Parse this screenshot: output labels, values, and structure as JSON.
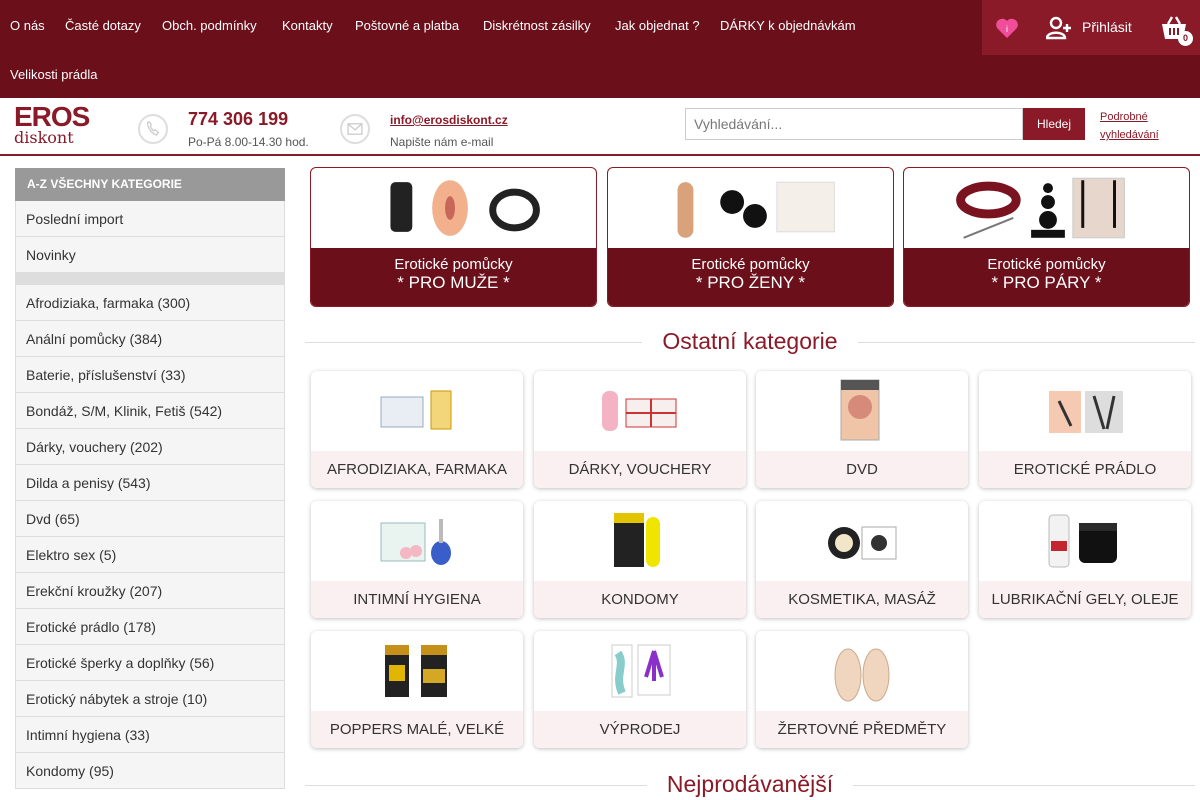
{
  "topnav": {
    "links": [
      "O nás",
      "Časté dotazy",
      "Obch. podmínky",
      "Kontakty",
      "Poštovné a platba",
      "Diskrétnost zásilky",
      "Jak objednat ?",
      "DÁRKY k objednávkám",
      "Velikosti prádla"
    ],
    "wishlist_badge": "i",
    "login_label": "Přihlásit",
    "cart_count": "0"
  },
  "header": {
    "logo_top": "EROS",
    "logo_bottom": "diskont",
    "phone": "774 306 199",
    "phone_hours": "Po-Pá 8.00-14.30 hod.",
    "email": "info@erosdiskont.cz",
    "email_note": "Napište nám e-mail",
    "search_placeholder": "Vyhledávání...",
    "search_button": "Hledej",
    "advanced_search": "Podrobné vyhledávání"
  },
  "sidebar": {
    "title": "A-Z VŠECHNY KATEGORIE",
    "top_items": [
      "Poslední import",
      "Novinky"
    ],
    "items": [
      "Afrodiziaka, farmaka (300)",
      "Anální pomůcky (384)",
      "Baterie, příslušenství (33)",
      "Bondáž, S/M, Klinik, Fetiš (542)",
      "Dárky, vouchery (202)",
      "Dilda a penisy (543)",
      "Dvd (65)",
      "Elektro sex (5)",
      "Erekční kroužky (207)",
      "Erotické prádlo (178)",
      "Erotické šperky a doplňky (56)",
      "Erotický nábytek a stroje (10)",
      "Intimní hygiena (33)",
      "Kondomy (95)"
    ]
  },
  "featured": [
    {
      "line1": "Erotické pomůcky",
      "line2": "* PRO MUŽE *"
    },
    {
      "line1": "Erotické pomůcky",
      "line2": "* PRO ŽENY *"
    },
    {
      "line1": "Erotické pomůcky",
      "line2": "* PRO PÁRY *"
    }
  ],
  "sections": {
    "other": "Ostatní kategorie",
    "bestsellers": "Nejprodávanější"
  },
  "categories": [
    "AFRODIZIAKA, FARMAKA",
    "DÁRKY, VOUCHERY",
    "DVD",
    "EROTICKÉ PRÁDLO",
    "INTIMNÍ HYGIENA",
    "KONDOMY",
    "KOSMETIKA, MASÁŽ",
    "LUBRIKAČNÍ GELY, OLEJE",
    "POPPERS MALÉ, VELKÉ",
    "VÝPRODEJ",
    "ŽERTOVNÉ PŘEDMĚTY"
  ],
  "colors": {
    "brand": "#8a1a27",
    "brand_dark": "#6b0f1a",
    "card_label_bg": "#fbf0f1"
  }
}
